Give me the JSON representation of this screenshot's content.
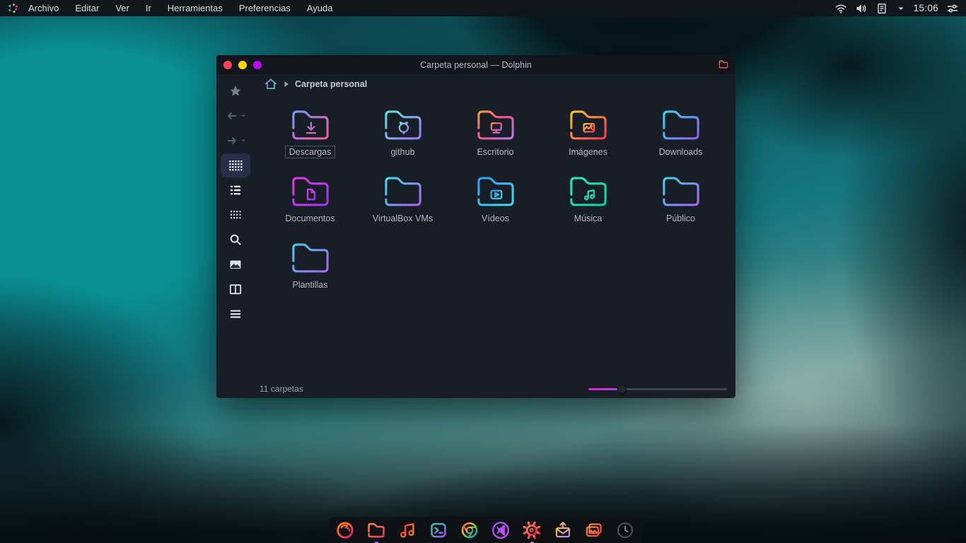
{
  "panel": {
    "menu_items": [
      "Archivo",
      "Editar",
      "Ver",
      "Ir",
      "Herramientas",
      "Preferencias",
      "Ayuda"
    ],
    "tray_icons": [
      "wifi",
      "volume",
      "clipboard",
      "caret-down"
    ],
    "clock": "15:06"
  },
  "window": {
    "title": "Carpeta personal — Dolphin",
    "titlebar_buttons": [
      {
        "name": "close",
        "color": "#f9455a"
      },
      {
        "name": "minimize",
        "color": "#ffd308"
      },
      {
        "name": "maximize",
        "color": "#bc0af0"
      }
    ],
    "breadcrumb": {
      "label": "Carpeta personal"
    },
    "sidebar_buttons": [
      {
        "icon": "star",
        "active": false
      },
      {
        "icon": "arrow-back",
        "active": false,
        "caret": true
      },
      {
        "icon": "arrow-forward",
        "active": false,
        "caret": true
      },
      {
        "icon": "view-grid",
        "active": true
      },
      {
        "icon": "view-list",
        "active": false
      },
      {
        "icon": "view-details",
        "active": false
      },
      {
        "icon": "search",
        "active": false
      },
      {
        "icon": "preview",
        "active": false
      },
      {
        "icon": "split",
        "active": false
      },
      {
        "icon": "menu",
        "active": false
      }
    ],
    "folders": [
      {
        "name": "Descargas",
        "emblem": "download",
        "colors": [
          "#63a4f7",
          "#b872d8",
          "#ef5f9a"
        ],
        "selected": true
      },
      {
        "name": "github",
        "emblem": "github",
        "colors": [
          "#5ee0d8",
          "#a07bf5"
        ],
        "selected": false
      },
      {
        "name": "Escritorio",
        "emblem": "monitor",
        "colors": [
          "#f59a45",
          "#ee5590",
          "#b873e8"
        ],
        "selected": false
      },
      {
        "name": "Imágenes",
        "emblem": "picture",
        "colors": [
          "#f8c630",
          "#f43d56"
        ],
        "selected": false
      },
      {
        "name": "Downloads",
        "emblem": "none",
        "colors": [
          "#35d6f0",
          "#8e64f2"
        ],
        "selected": false
      },
      {
        "name": "Documentos",
        "emblem": "document",
        "colors": [
          "#e438dd",
          "#9d37f2"
        ],
        "selected": false
      },
      {
        "name": "VirtualBox VMs",
        "emblem": "none",
        "colors": [
          "#3fd9e8",
          "#a468ef"
        ],
        "selected": false
      },
      {
        "name": "Vídeos",
        "emblem": "video",
        "colors": [
          "#2f9ff2",
          "#45d4e8"
        ],
        "selected": false
      },
      {
        "name": "Música",
        "emblem": "music",
        "colors": [
          "#2aeab2",
          "#14cfa0"
        ],
        "selected": false
      },
      {
        "name": "Público",
        "emblem": "none",
        "colors": [
          "#3fd0ea",
          "#a468ef"
        ],
        "selected": false
      },
      {
        "name": "Plantillas",
        "emblem": "none",
        "colors": [
          "#3fd0ea",
          "#a468ef"
        ],
        "selected": false
      }
    ],
    "status": "11 carpetas",
    "zoom_slider": {
      "value_pct": 24,
      "fill_from": "#e91ec8",
      "fill_to": "#a34df0",
      "track": "#40464e"
    }
  },
  "dock": {
    "items": [
      {
        "icon": "firefox",
        "c": [
          "#ff9400",
          "#e31587"
        ]
      },
      {
        "icon": "files",
        "c": [
          "#ff8a3d",
          "#f43f5e"
        ],
        "indicator": "#a855f7"
      },
      {
        "icon": "music-player",
        "c": [
          "#ff3d3d",
          "#ff9100"
        ]
      },
      {
        "icon": "terminal",
        "c": [
          "#2dd4bf",
          "#a855f7"
        ]
      },
      {
        "icon": "chrome",
        "c": [
          "#ef4444",
          "#fbbf24",
          "#22c55e",
          "#3b82f6"
        ]
      },
      {
        "icon": "vscode",
        "c": [
          "#8b5cf6",
          "#d946ef"
        ]
      },
      {
        "icon": "settings",
        "c": [
          "#fb923c",
          "#e11d48"
        ],
        "indicator": "#8b9096"
      },
      {
        "icon": "mail",
        "c": [
          "#fbbf24",
          "#c084fc"
        ]
      },
      {
        "icon": "photos",
        "c": [
          "#fb923c",
          "#ef4444"
        ]
      },
      {
        "icon": "clock-app",
        "c": [
          "#4e545b",
          "#4e545b"
        ]
      }
    ]
  }
}
